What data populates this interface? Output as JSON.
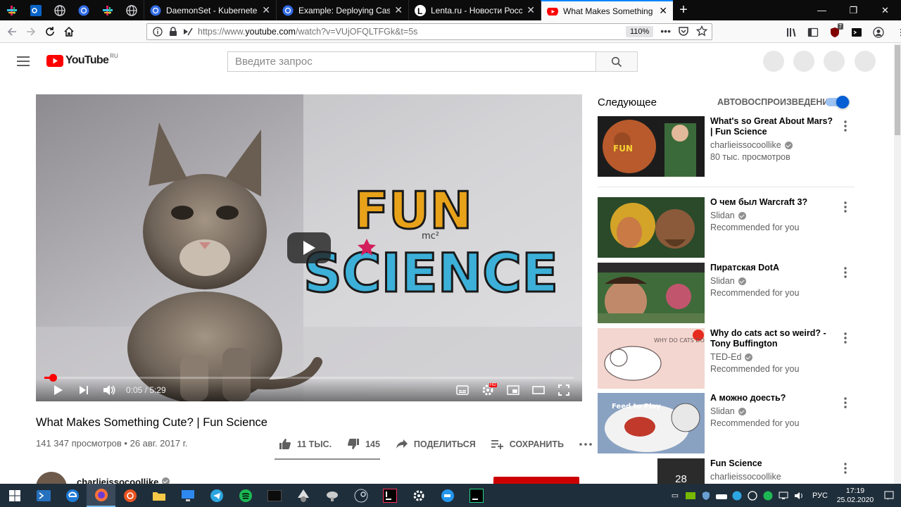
{
  "browser": {
    "tabs": [
      {
        "title": "DaemonSet - Kubernetes",
        "icon": "kubernetes-icon"
      },
      {
        "title": "Example: Deploying Cassandra",
        "icon": "kubernetes-icon"
      },
      {
        "title": "Lenta.ru - Новости России и м",
        "icon": "lenta-icon"
      },
      {
        "title": "What Makes Something Cute? |",
        "icon": "youtube-icon",
        "active": true
      }
    ],
    "url_prefix": "https://www.",
    "url_domain": "youtube.com",
    "url_rest": "/watch?v=VUjOFQLTFGk&t=5s",
    "zoom": "110%",
    "ublock_count": "7"
  },
  "youtube": {
    "logo_text": "YouTube",
    "region": "RU",
    "search_placeholder": "Введите запрос"
  },
  "player": {
    "title_art": {
      "line1": "FUN",
      "line2": "SCIENCE",
      "mc2": "mc²"
    },
    "time_current": "0:05",
    "time_total": "5:29",
    "progress_fraction": 0.016,
    "hd_badge": "HD"
  },
  "video": {
    "title": "What Makes Something Cute? | Fun Science",
    "views": "141 347 просмотров",
    "date": "26 авг. 2017 г.",
    "likes": "11 ТЫС.",
    "dislikes": "145",
    "share_label": "ПОДЕЛИТЬСЯ",
    "save_label": "СОХРАНИТЬ",
    "like_fraction": 0.987,
    "channel": "charlieissocoollike"
  },
  "sidebar": {
    "up_next": "Следующее",
    "autoplay_label": "АВТОВОСПРОИЗВЕДЕНИЕ",
    "autoplay_on": true,
    "items": [
      {
        "title": "What's so Great About Mars? | Fun Science",
        "channel": "charlieissocoollike",
        "meta": "80 тыс. просмотров"
      },
      {
        "title": "О чем был Warcraft 3?",
        "channel": "Slidan",
        "meta": "Recommended for you"
      },
      {
        "title": "Пиратская DotA",
        "channel": "Slidan",
        "meta": "Recommended for you"
      },
      {
        "title": "Why do cats act so weird? - Tony Buffington",
        "channel": "TED-Ed",
        "meta": "Recommended for you",
        "thumb_text": "WHY DO CATS DO THAT?"
      },
      {
        "title": "А можно доесть?",
        "channel": "Slidan",
        "meta": "Recommended for you",
        "thumb_text": "Feed to Play"
      },
      {
        "title": "Fun Science",
        "channel": "charlieissocoollike",
        "meta": "",
        "playlist_count": "28"
      }
    ]
  },
  "taskbar": {
    "lang": "РУС",
    "time": "17:19",
    "date": "25.02.2020"
  }
}
